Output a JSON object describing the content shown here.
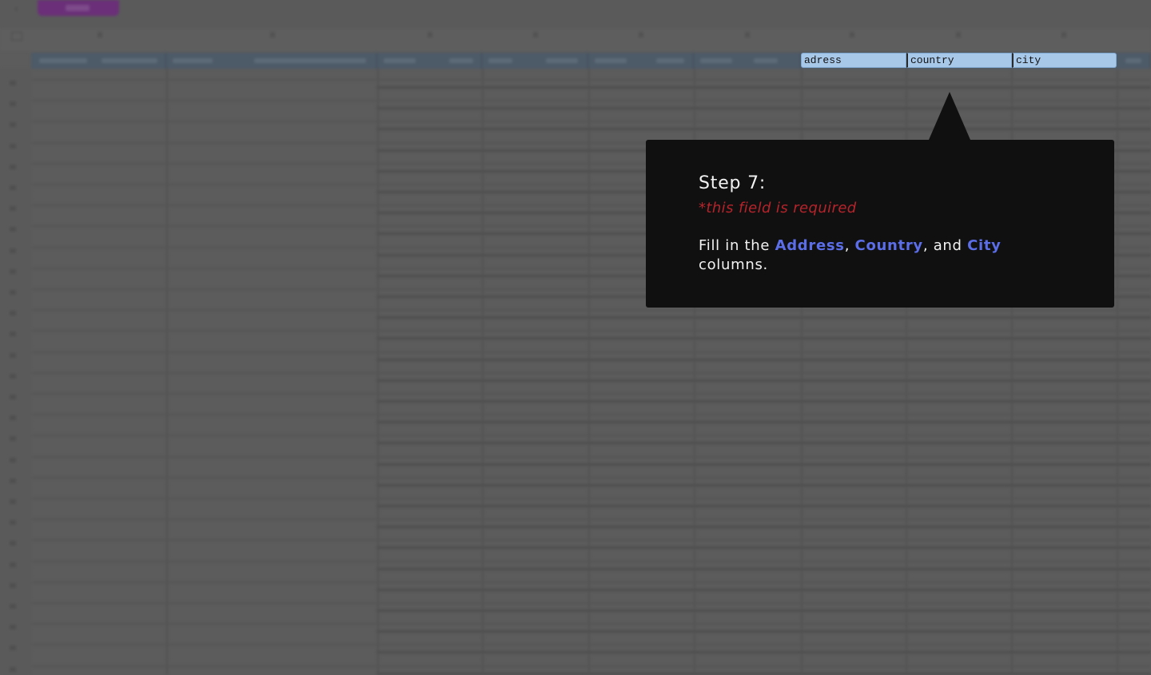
{
  "highlighted_headers": [
    {
      "label": "adress"
    },
    {
      "label": "country"
    },
    {
      "label": "city"
    }
  ],
  "tooltip": {
    "title": "Step 7:",
    "required": "*this field is required",
    "intro": "Fill in the ",
    "term1": "Address",
    "sep1": ", ",
    "term2": "Country",
    "sep2": ", and ",
    "term3": "City",
    "outro": "columns."
  },
  "colors": {
    "accent_text": "#5b6ee8",
    "required_text": "#b5242b",
    "header_highlight": "#a8c8ea",
    "tooltip_bg": "#101010",
    "toolbar_pill": "#6a2f78"
  }
}
